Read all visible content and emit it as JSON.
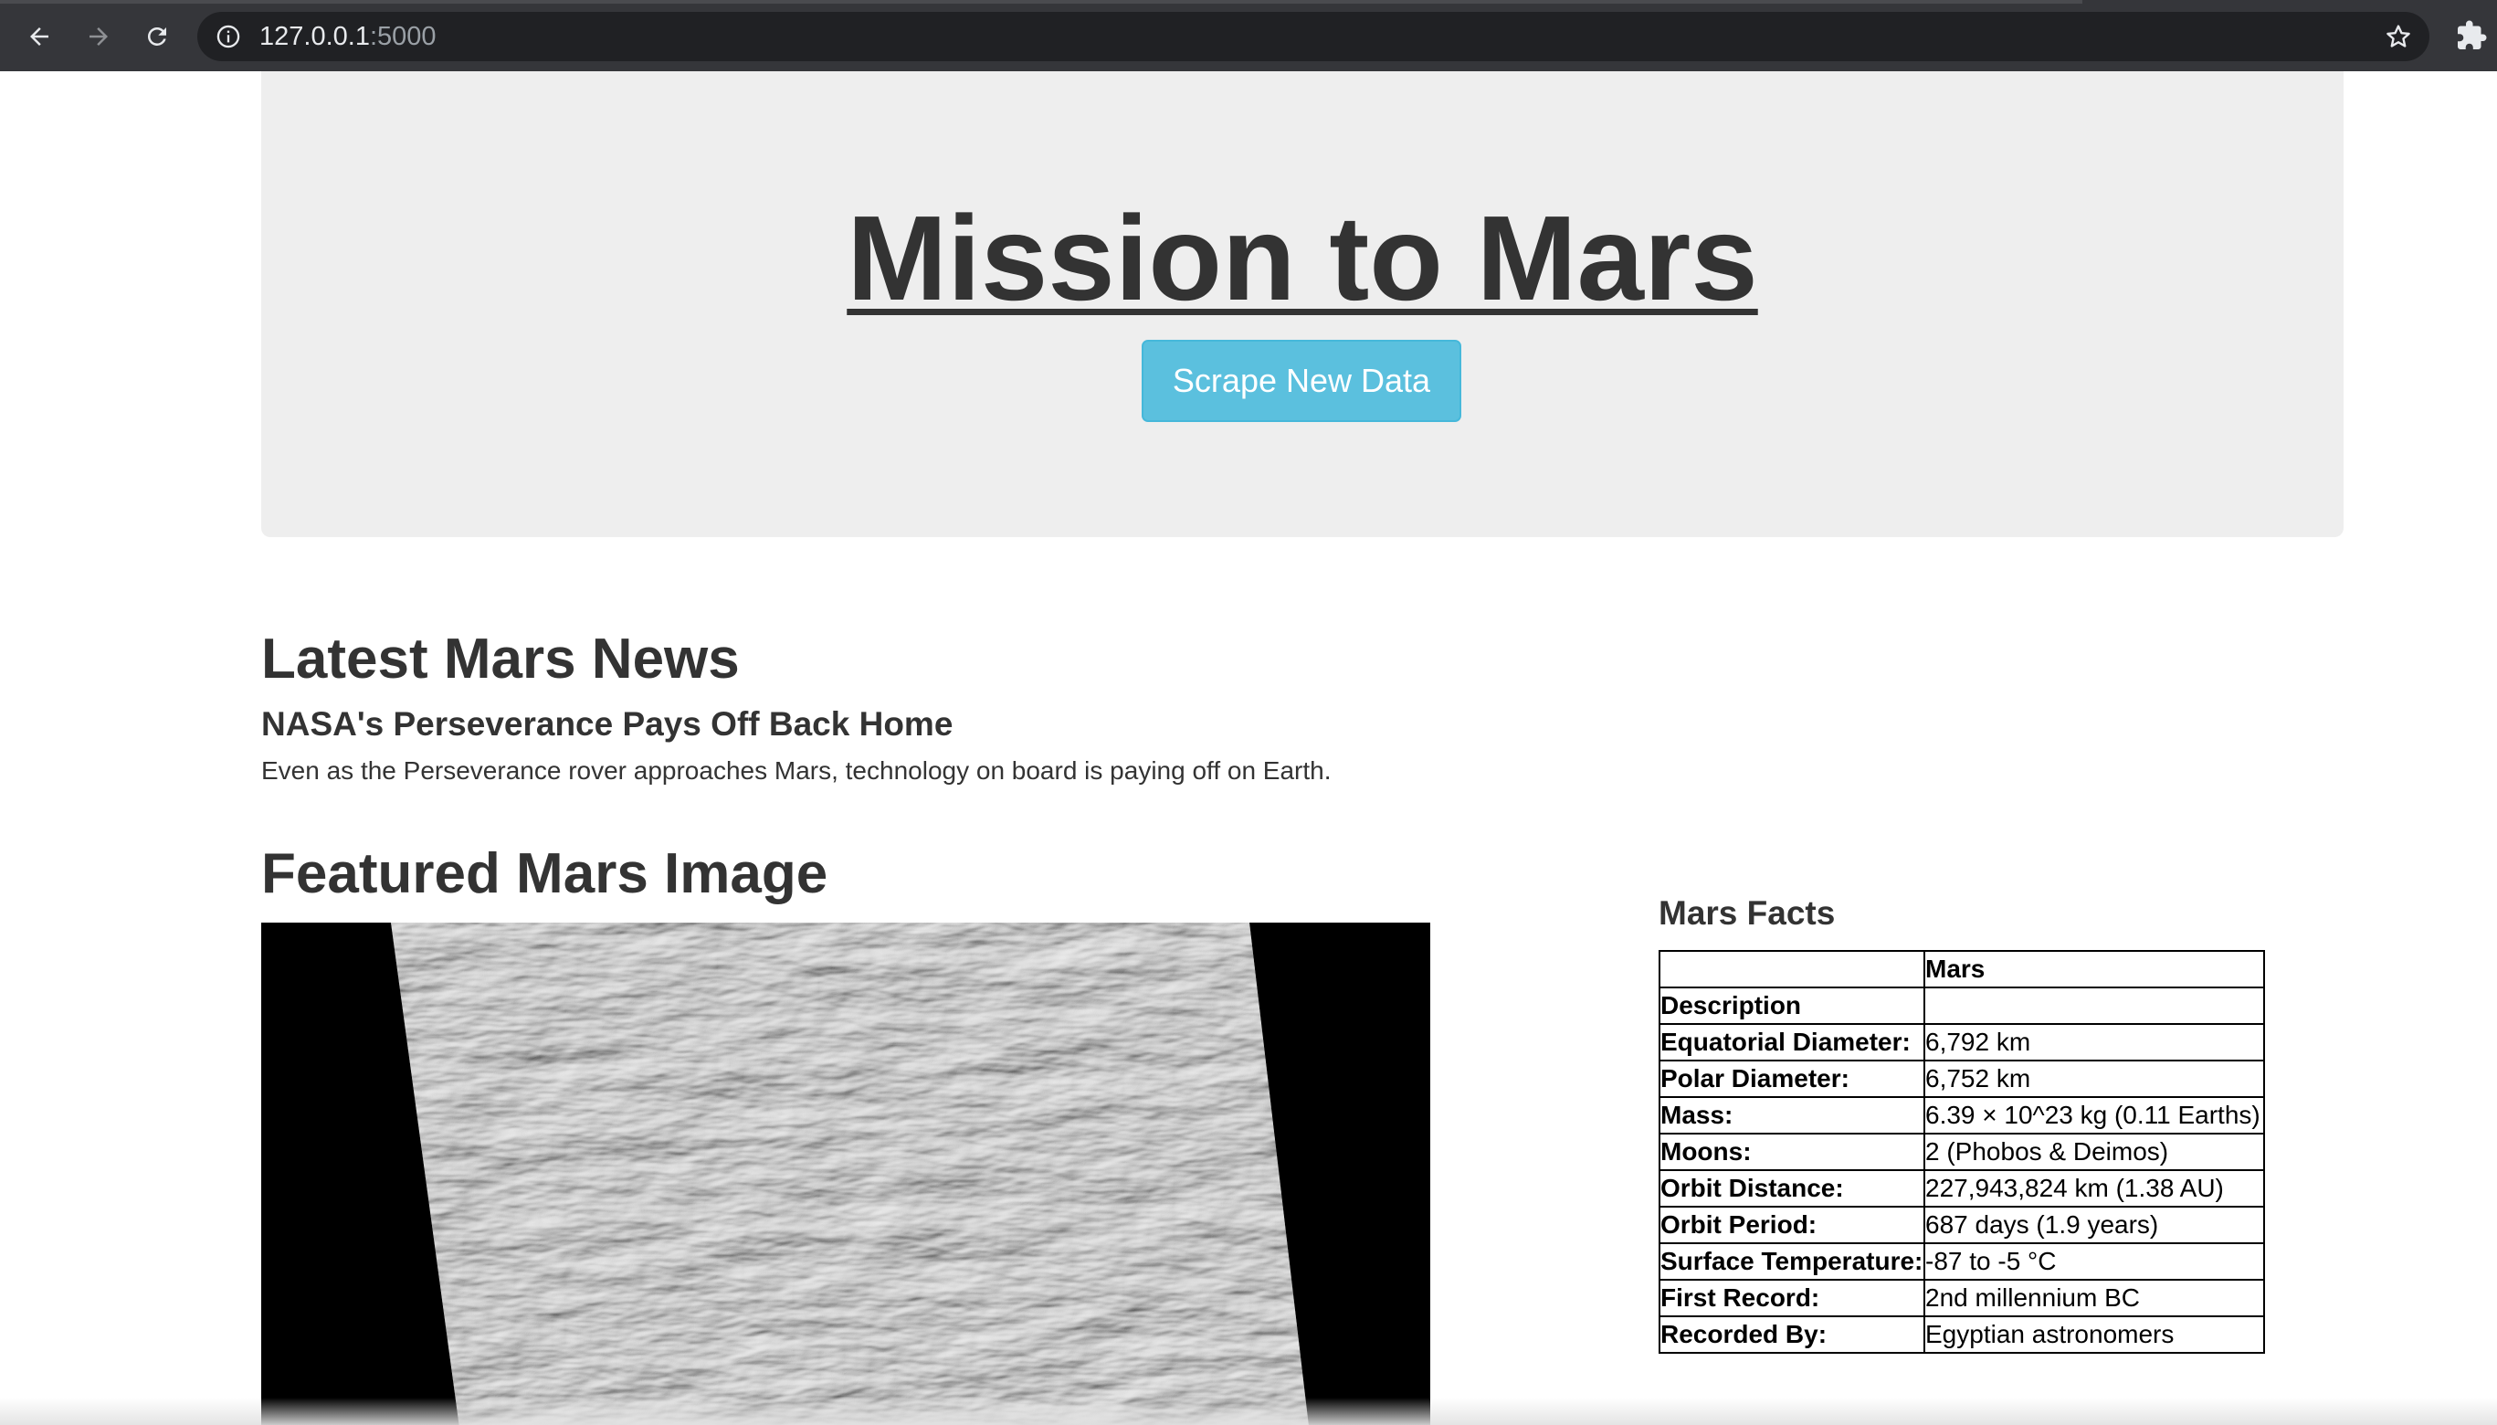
{
  "browser": {
    "url_host": "127.0.0.1",
    "url_port": ":5000",
    "icons": [
      "back-arrow-icon",
      "forward-arrow-icon",
      "reload-icon",
      "info-icon",
      "star-icon",
      "extensions-puzzle-icon"
    ]
  },
  "header": {
    "title": "Mission to Mars",
    "scrape_button": "Scrape New Data",
    "accent_color": "#5bc0de"
  },
  "news": {
    "heading": "Latest Mars News",
    "title": "NASA's Perseverance Pays Off Back Home",
    "teaser": "Even as the Perseverance rover approaches Mars, technology on board is paying off on Earth."
  },
  "featured": {
    "heading": "Featured Mars Image"
  },
  "facts": {
    "heading": "Mars Facts",
    "column_header": "Mars",
    "rows": [
      {
        "label": "Description",
        "value": ""
      },
      {
        "label": "Equatorial Diameter:",
        "value": "6,792 km"
      },
      {
        "label": "Polar Diameter:",
        "value": "6,752 km"
      },
      {
        "label": "Mass:",
        "value": "6.39 × 10^23 kg (0.11 Earths)"
      },
      {
        "label": "Moons:",
        "value": "2 (Phobos & Deimos)"
      },
      {
        "label": "Orbit Distance:",
        "value": "227,943,824 km (1.38 AU)"
      },
      {
        "label": "Orbit Period:",
        "value": "687 days (1.9 years)"
      },
      {
        "label": "Surface Temperature:",
        "value": "-87 to -5 °C"
      },
      {
        "label": "First Record:",
        "value": "2nd millennium BC"
      },
      {
        "label": "Recorded By:",
        "value": "Egyptian astronomers"
      }
    ]
  }
}
